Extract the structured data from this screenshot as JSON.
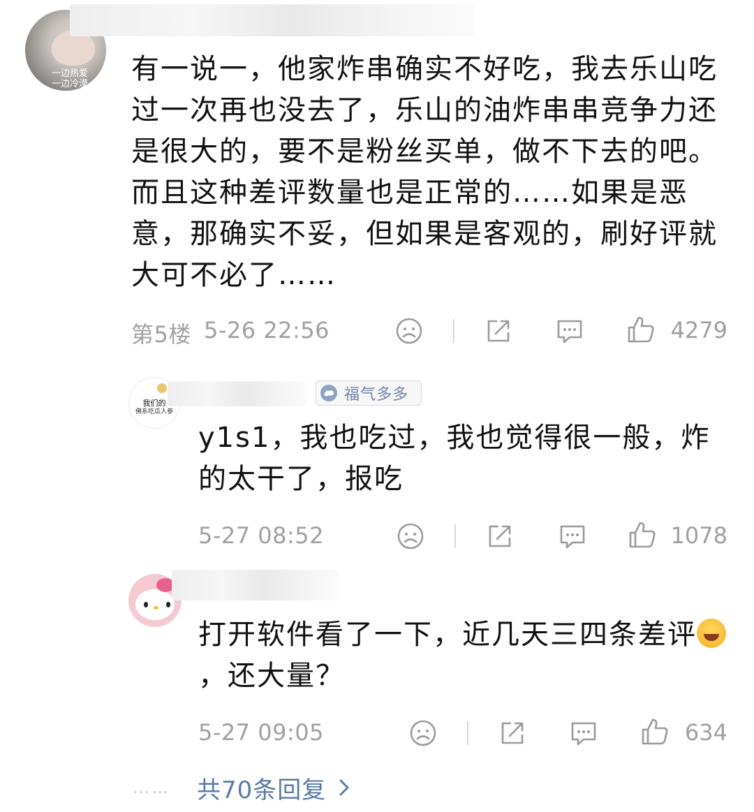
{
  "comments": [
    {
      "avatar_caption": "一边热爱\n一边冷漠",
      "text": "有一说一，他家炸串确实不好吃，我去乐山吃过一次再也没去了，乐山的油炸串串竞争力还是很大的，要不是粉丝买单，做不下去的吧。而且这种差评数量也是正常的……如果是恶意，那确实不妥，但如果是客观的，刷好评就大可不必了……",
      "floor": "第5楼",
      "time": "5-26 22:56",
      "likes": "4279"
    },
    {
      "avatar_caption_1": "我们的",
      "avatar_caption_2": "佛系吃瓜人参",
      "badge": "福气多多",
      "text": "y1s1，我也吃过，我也觉得很一般，炸的太干了，报吃",
      "time": "5-27 08:52",
      "likes": "1078"
    },
    {
      "text_before_emoji": "打开软件看了一下，近几天三四条差评",
      "text_after_emoji": "，还大量？",
      "time": "5-27 09:05",
      "likes": "634"
    }
  ],
  "more_replies": {
    "dots": "……",
    "label": "共70条回复"
  },
  "icons": [
    "sad-face-icon",
    "share-icon",
    "comment-icon",
    "thumbs-up-icon",
    "chevron-right-icon"
  ],
  "colors": {
    "meta_gray": "#a0a0a0",
    "link_blue": "#5a7aa8",
    "badge_blue": "#6f86a6"
  }
}
